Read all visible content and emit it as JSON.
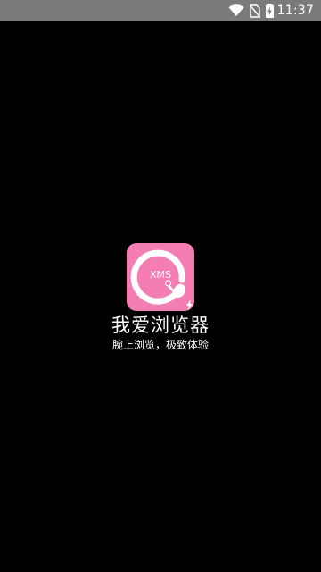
{
  "status_bar": {
    "time": "11:37",
    "icons": [
      "wifi-icon",
      "no-sim-icon",
      "battery-charging-icon"
    ]
  },
  "splash": {
    "logo_text": "XMS",
    "app_name": "我爱浏览器",
    "slogan": "腕上浏览，极致体验"
  },
  "colors": {
    "background": "#000000",
    "status_bar": "#7a7a7a",
    "logo_pink": "#f47eb4",
    "text": "#ffffff"
  }
}
